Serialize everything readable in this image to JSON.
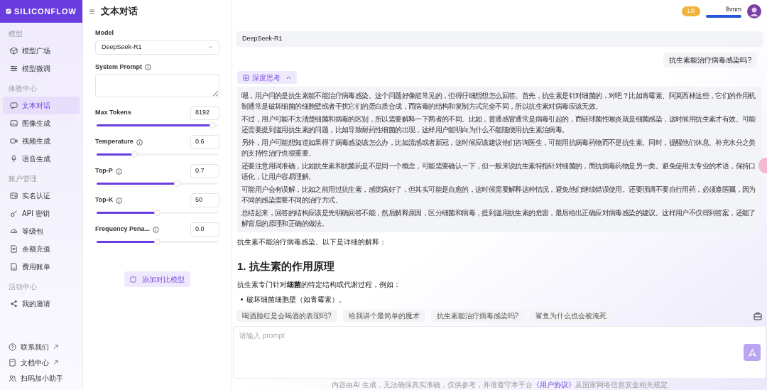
{
  "header": {
    "logo": "SILICONFLOW",
    "title": "文本对话",
    "level_badge": "L0",
    "username": "lhmm"
  },
  "sidebar": {
    "sections": [
      {
        "heading": "模型",
        "items": [
          {
            "label": "模型广场",
            "selected": false
          },
          {
            "label": "模型微调",
            "selected": false
          }
        ]
      },
      {
        "heading": "体验中心",
        "items": [
          {
            "label": "文本对话",
            "selected": true
          },
          {
            "label": "图像生成",
            "selected": false
          },
          {
            "label": "视频生成",
            "selected": false
          },
          {
            "label": "语音生成",
            "selected": false
          }
        ]
      },
      {
        "heading": "账户管理",
        "items": [
          {
            "label": "实名认证",
            "selected": false
          },
          {
            "label": "API 密钥",
            "selected": false
          },
          {
            "label": "等级包",
            "selected": false
          },
          {
            "label": "余额充值",
            "selected": false
          },
          {
            "label": "费用账单",
            "selected": false
          }
        ]
      },
      {
        "heading": "活动中心",
        "items": [
          {
            "label": "我的邀请",
            "selected": false
          }
        ]
      }
    ],
    "footer_links": [
      {
        "label": "联系我们",
        "external": true
      },
      {
        "label": "文档中心",
        "external": true
      },
      {
        "label": "扫码加小助手",
        "external": false
      }
    ]
  },
  "params": [
    {
      "kind": "select",
      "label": "Model",
      "value": "DeepSeek-R1",
      "info_icon": false
    },
    {
      "kind": "textarea",
      "label": "System Prompt",
      "info_icon": true
    },
    {
      "kind": "slider",
      "label": "Max Tokens",
      "value": "8192",
      "level": 0.98,
      "info_icon": false
    },
    {
      "kind": "slider",
      "label": "Temperature",
      "value": "0.6",
      "level": 0.3,
      "info_icon": true
    },
    {
      "kind": "slider",
      "label": "Top-P",
      "value": "0.7",
      "level": 0.67,
      "info_icon": true
    },
    {
      "kind": "slider",
      "label": "Top-K",
      "value": "50",
      "level": 0.5,
      "info_icon": true
    },
    {
      "kind": "slider",
      "label": "Frequency Pena...",
      "value": "0.0",
      "level": 0.5,
      "info_icon": true
    }
  ],
  "add_compare_button": "添加对比模型",
  "chat": {
    "model_name": "DeepSeek-R1",
    "user_message": "抗生素能治疗病毒感染吗?",
    "thinking": {
      "label": "深度思考",
      "expanded": true,
      "paragraphs": [
        "嗯，用户问的是抗生素能不能治疗病毒感染。这个问题好像挺常见的，但得仔细想想怎么回答。首先，抗生素是针对细菌的，对吧？比如青霉素、阿莫西林这些，它们的作用机制通常是破坏细菌的细胞壁或者干扰它们的蛋白质合成，而病毒的结构和复制方式完全不同，所以抗生素对病毒应该无效。",
        "不过，用户可能不太清楚细菌和病毒的区别，所以需要解释一下两者的不同。比如，普通感冒通常是病毒引起的，而链球菌性喉炎就是细菌感染，这时候用抗生素才有效。可能还需要提到滥用抗生素的问题，比如导致耐药性细菌的出现，这样用户能明白为什么不能随便用抗生素治病毒。",
        "另外，用户可能想知道如果得了病毒感染该怎么办，比如流感或者新冠，这时候应该建议他们咨询医生，可能用抗病毒药物而不是抗生素。同时，提醒他们休息、补充水分之类的支持性治疗也很重要。",
        "还要注意用词准确，比如抗生素和抗菌药是不是同一个概念，可能需要确认一下，但一般来说抗生素特指针对细菌的，而抗病毒药物是另一类。避免使用太专业的术语，保持口语化，让用户容易理解。",
        "可能用户会有误解，比如之前用过抗生素，感觉病好了，但其实可能是自愈的，这时候需要解释这种情况，避免他们继续错误使用。还要强调不要自行用药，必须遵医嘱，因为不同的感染需要不同的治疗方式。",
        "总结起来，回答的结构应该是先明确回答不能，然后解释原因，区分细菌和病毒，提到滥用抗生素的危害，最后给出正确应对病毒感染的建议。这样用户不仅得到答案，还能了解背后的原理和正确的做法。"
      ]
    },
    "answer": [
      {
        "kind": "paragraph",
        "text": "抗生素不能治疗病毒感染。以下是详细的解释："
      },
      {
        "kind": "heading",
        "text": "1. 抗生素的作用原理"
      },
      {
        "kind": "paragraph",
        "text": "抗生素专门针对**细菌**的特定结构或代谢过程，例如："
      },
      {
        "kind": "bullet",
        "text": "破坏细菌细胞壁（如青霉素）。"
      }
    ],
    "suggestions": [
      "喝酒脸红是会喝酒的表现吗?",
      "给我讲个最简单的魔术",
      "抗生素能治疗病毒感染吗?",
      "鲨鱼为什么也会被淹死"
    ],
    "input": {
      "placeholder": "请输入 prompt"
    },
    "disclaimer": {
      "before": "内容由AI 生成，无法确保真实准确，仅供参考，并请遵守本平台",
      "link": "《用户协议》",
      "after": "及国家网络信息安全相关规定"
    }
  }
}
